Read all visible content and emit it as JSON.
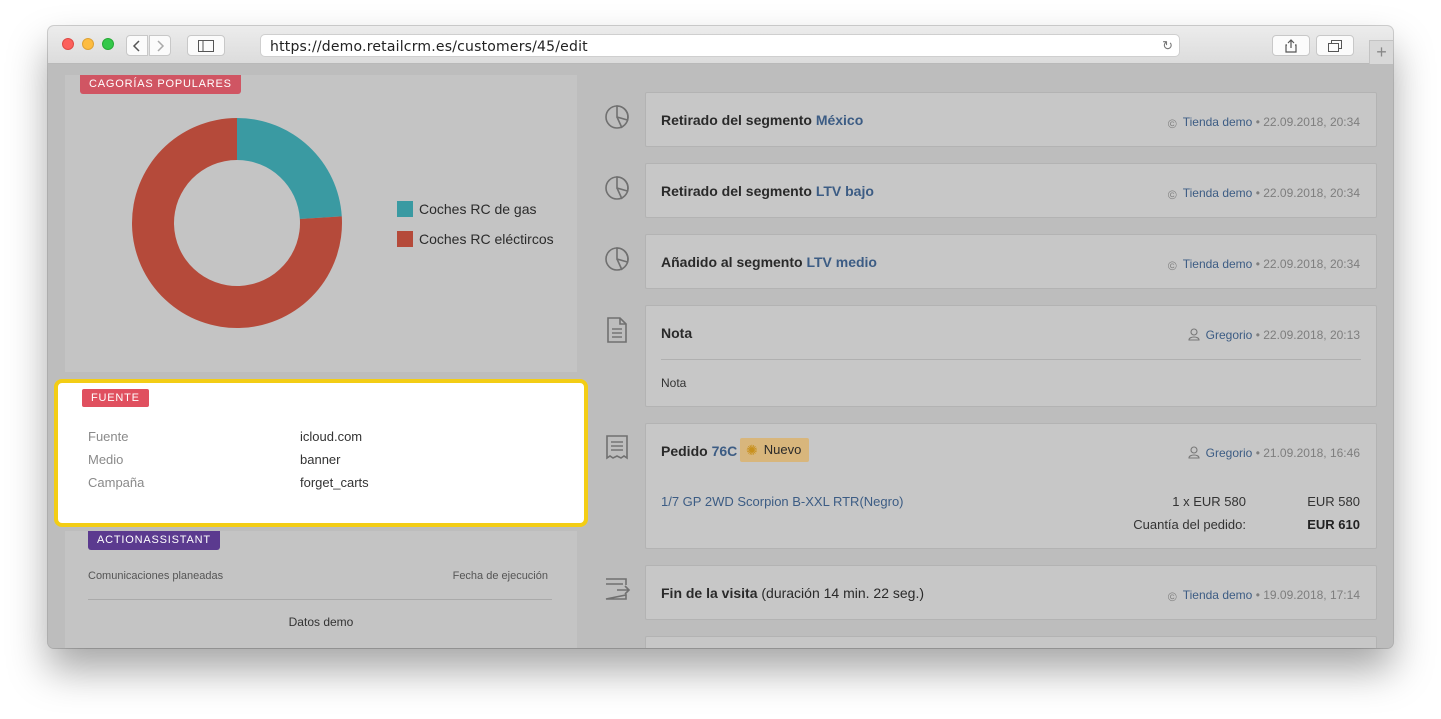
{
  "browser": {
    "url": "https://demo.retailcrm.es/customers/45/edit"
  },
  "categories_panel": {
    "ribbon": "CAGORÍAS POPULARES"
  },
  "chart_data": {
    "type": "pie",
    "categories": [
      "Coches RC de gas",
      "Coches RC eléctircos"
    ],
    "values": [
      24,
      76
    ],
    "colors": [
      "#3a9aa2",
      "#b54a3a"
    ],
    "legend": "right",
    "donut": true
  },
  "source_panel": {
    "ribbon": "FUENTE",
    "rows": [
      {
        "label": "Fuente",
        "value": "icloud.com"
      },
      {
        "label": "Medio",
        "value": "banner"
      },
      {
        "label": "Campaña",
        "value": "forget_carts"
      }
    ],
    "highlight_color": "#f3cd15"
  },
  "assistant_panel": {
    "ribbon": "ACTIONASSISTANT",
    "col_left": "Comunicaciones planeadas",
    "col_right": "Fecha de ejecución",
    "empty_text": "Datos demo"
  },
  "events": [
    {
      "title": "Retirado del segmento",
      "link": "México",
      "source": "Tienda demo",
      "date": "22.09.2018, 20:34",
      "icon": "segment-icon"
    },
    {
      "title": "Retirado del segmento",
      "link": "LTV bajo",
      "source": "Tienda demo",
      "date": "22.09.2018, 20:34",
      "icon": "segment-icon"
    },
    {
      "title": "Añadido al segmento",
      "link": "LTV medio",
      "source": "Tienda demo",
      "date": "22.09.2018, 20:34",
      "icon": "segment-icon"
    },
    {
      "title": "Nota",
      "body": "Nota",
      "source": "Gregorio",
      "date": "22.09.2018, 20:13",
      "icon": "note-icon"
    },
    {
      "title": "Pedido",
      "link": "76C",
      "status": "Nuevo",
      "source": "Gregorio",
      "date": "21.09.2018, 16:46",
      "icon": "order-icon",
      "item_name": "1/7 GP 2WD Scorpion B-XXL RTR(Negro)",
      "item_qty": "1 x EUR 580",
      "item_total": "EUR 580",
      "total_label": "Cuantía del pedido:",
      "total_value": "EUR 610"
    },
    {
      "title": "Fin de la visita",
      "detail": "(duración 14 min. 22 seg.)",
      "source": "Tienda demo",
      "date": "19.09.2018, 17:14",
      "icon": "visit-end-icon"
    }
  ],
  "colors": {
    "ribbon_red": "#e0505f",
    "ribbon_purple": "#5b3a8f",
    "link_blue": "#3c5c84",
    "status_badge": "#d8b67c"
  }
}
